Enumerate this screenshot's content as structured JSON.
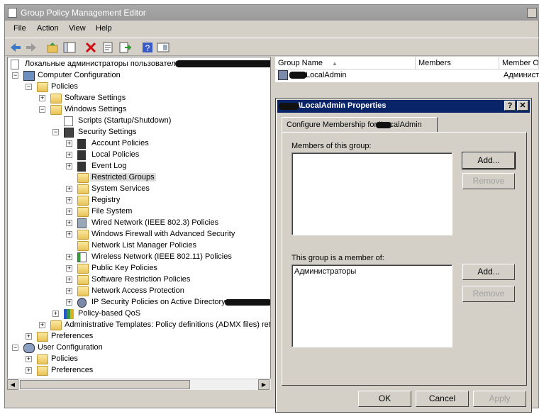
{
  "window": {
    "title": "Group Policy Management Editor"
  },
  "menu": [
    "File",
    "Action",
    "View",
    "Help"
  ],
  "tree": {
    "items": [
      {
        "label": "Локальные администраторы пользователе"
      },
      {
        "label": "Computer Configuration"
      },
      {
        "label": "Policies"
      },
      {
        "label": "Software Settings"
      },
      {
        "label": "Windows Settings"
      },
      {
        "label": "Scripts (Startup/Shutdown)"
      },
      {
        "label": "Security Settings"
      },
      {
        "label": "Account Policies"
      },
      {
        "label": "Local Policies"
      },
      {
        "label": "Event Log"
      },
      {
        "label": "Restricted Groups"
      },
      {
        "label": "System Services"
      },
      {
        "label": "Registry"
      },
      {
        "label": "File System"
      },
      {
        "label": "Wired Network (IEEE 802.3) Policies"
      },
      {
        "label": "Windows Firewall with Advanced Security"
      },
      {
        "label": "Network List Manager Policies"
      },
      {
        "label": "Wireless Network (IEEE 802.11) Policies"
      },
      {
        "label": "Public Key Policies"
      },
      {
        "label": "Software Restriction Policies"
      },
      {
        "label": "Network Access Protection"
      },
      {
        "label": "IP Security Policies on Active Directory"
      },
      {
        "label": "Policy-based QoS"
      },
      {
        "label": "Administrative Templates: Policy definitions (ADMX files) retr"
      },
      {
        "label": "Preferences"
      },
      {
        "label": "User Configuration"
      },
      {
        "label": "Policies"
      },
      {
        "label": "Preferences"
      }
    ]
  },
  "list": {
    "columns": [
      "Group Name",
      "Members",
      "Member O"
    ],
    "rows": [
      {
        "name": "\\LocalAdmin",
        "members": "",
        "member_of": "Админист"
      }
    ]
  },
  "dialog": {
    "title": "\\LocalAdmin Properties",
    "help_btn": "?",
    "close_btn": "✕",
    "tab": "Configure Membership for \\LocalAdmin",
    "members_label": "Members of this group:",
    "memberof_label": "This group is a member of:",
    "memberof_items": [
      "Администраторы"
    ],
    "add_label": "Add...",
    "remove_label": "Remove",
    "ok": "OK",
    "cancel": "Cancel",
    "apply": "Apply"
  }
}
